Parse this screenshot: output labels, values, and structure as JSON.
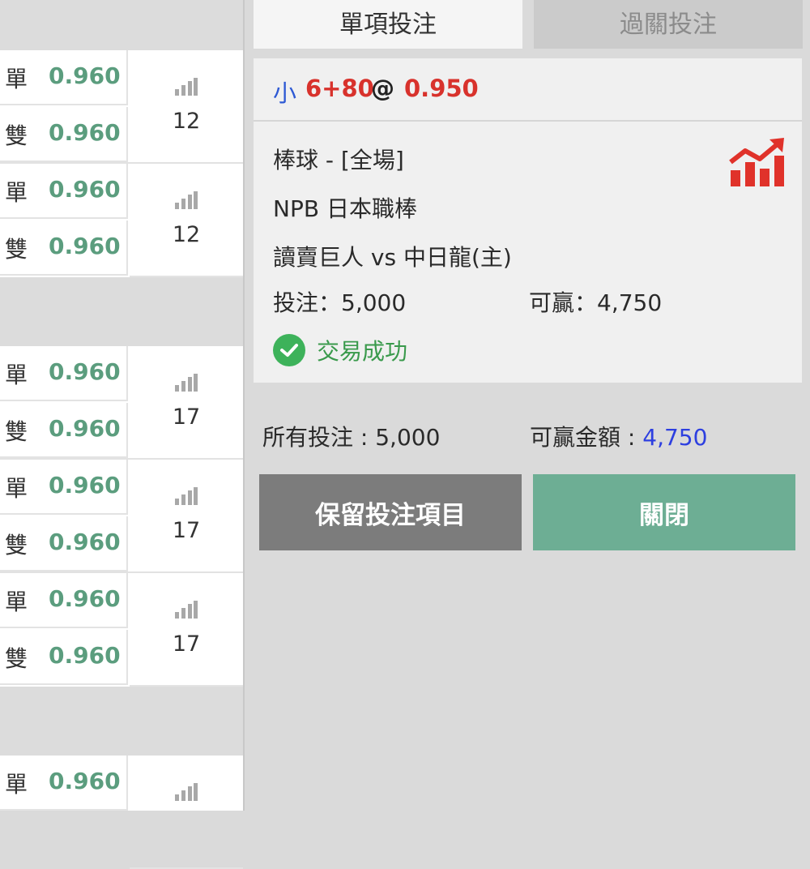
{
  "odds_list": {
    "groups": [
      {
        "pairs": [
          {
            "rows": [
              {
                "label": "單",
                "odds": "0.960"
              },
              {
                "label": "雙",
                "odds": "0.960"
              }
            ],
            "count": "12"
          },
          {
            "rows": [
              {
                "label": "單",
                "odds": "0.960"
              },
              {
                "label": "雙",
                "odds": "0.960"
              }
            ],
            "count": "12"
          }
        ]
      },
      {
        "pairs": [
          {
            "rows": [
              {
                "label": "單",
                "odds": "0.960"
              },
              {
                "label": "雙",
                "odds": "0.960"
              }
            ],
            "count": "17"
          },
          {
            "rows": [
              {
                "label": "單",
                "odds": "0.960"
              },
              {
                "label": "雙",
                "odds": "0.960"
              }
            ],
            "count": "17"
          },
          {
            "rows": [
              {
                "label": "單",
                "odds": "0.960"
              },
              {
                "label": "雙",
                "odds": "0.960"
              }
            ],
            "count": "17"
          }
        ]
      },
      {
        "pairs": [
          {
            "rows": [
              {
                "label": "單",
                "odds": "0.960"
              }
            ],
            "count": ""
          }
        ]
      }
    ]
  },
  "tabs": {
    "single": "單項投注",
    "parlay": "過關投注"
  },
  "bet": {
    "selection": "小",
    "handicap": "6+80",
    "at": "@",
    "price": "0.950",
    "sport": "棒球 - [全場]",
    "league": "NPB 日本職棒",
    "match": "讀賣巨人 vs 中日龍(主)",
    "stake_label": "投注：5,000",
    "win_label": "可贏：4,750",
    "status": "交易成功"
  },
  "summary": {
    "total_stake": "所有投注 : 5,000",
    "total_win_label": "可贏金額 : ",
    "total_win_value": "4,750"
  },
  "buttons": {
    "keep": "保留投注項目",
    "close": "關閉"
  },
  "colors": {
    "odds_green": "#5b9d7e",
    "price_red": "#d8322c",
    "selection_blue": "#2d59d4",
    "close_button": "#6dae94",
    "keep_button": "#7c7c7c"
  },
  "icons": {
    "market": "bar-chart-icon",
    "trend": "trend-up-icon",
    "success": "check-circle-icon"
  }
}
